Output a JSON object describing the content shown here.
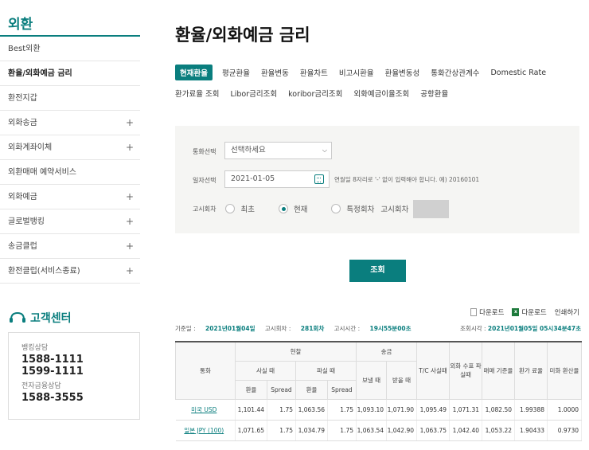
{
  "sidebar": {
    "title": "외환",
    "items": [
      {
        "label": "Best외환",
        "plus": ""
      },
      {
        "label": "환율/외화예금 금리",
        "plus": ""
      },
      {
        "label": "환전지갑",
        "plus": ""
      },
      {
        "label": "외화송금",
        "plus": "+"
      },
      {
        "label": "외화계좌이체",
        "plus": "+"
      },
      {
        "label": "외환매매 예약서비스",
        "plus": ""
      },
      {
        "label": "외화예금",
        "plus": "+"
      },
      {
        "label": "글로벌뱅킹",
        "plus": "+"
      },
      {
        "label": "송금클럽",
        "plus": "+"
      },
      {
        "label": "환전클럽(서비스종료)",
        "plus": "+"
      }
    ]
  },
  "customer_center": {
    "title": "고객센터",
    "bank_label": "뱅킹상담",
    "bank_num1": "1588-1111",
    "bank_num2": "1599-1111",
    "ef_label": "전자금융상담",
    "ef_num": "1588-3555"
  },
  "page_title": "환율/외화예금 금리",
  "tabs_row1": [
    "현재환율",
    "평균환율",
    "환율변동",
    "환율차트",
    "비고시환율",
    "환율변동성",
    "통화간상관계수",
    "Domestic Rate"
  ],
  "tabs_row2": [
    "환가료율 조회",
    "Libor금리조회",
    "koribor금리조회",
    "외화예금이율조회",
    "공항환율"
  ],
  "search": {
    "currency_label": "통화선택",
    "currency_value": "선택하세요",
    "date_label": "일자선택",
    "date_value": "2021-01-05",
    "date_hint": "연월일 8자리로 '-' 없이 입력해야 합니다. 예) 20160101",
    "notice_label": "고시회차",
    "opt_first": "최초",
    "opt_current": "현재",
    "opt_specific": "특정회차",
    "notice_round_label": "고시회차",
    "button": "조회"
  },
  "downloads": {
    "dl1": "다운로드",
    "dl2": "다운로드",
    "print": "인쇄하기"
  },
  "info": {
    "base_date_label": "기준일 :",
    "base_date": "2021년01월04일",
    "round_label": "고시회차 :",
    "round": "281회차",
    "time_label": "고시시간 :",
    "time": "19시55분00초",
    "query_label": "조회시각 :",
    "query_time": "2021년01월05일 05시34분47초"
  },
  "table": {
    "h_currency": "통화",
    "h_cash": "현찰",
    "h_remit": "송금",
    "h_tc": "T/C 사실때",
    "h_foreign_check": "외화 수표 파실때",
    "h_base": "매매 기준율",
    "h_conv": "환가 료율",
    "h_usd": "미화 환산율",
    "h_buy": "사실 때",
    "h_sell": "파실 때",
    "h_send": "보낼 때",
    "h_receive": "받을 때",
    "h_rate": "환율",
    "h_spread": "Spread",
    "rows": [
      [
        "미국 USD",
        "1,101.44",
        "1.75",
        "1,063.56",
        "1.75",
        "1,093.10",
        "1,071.90",
        "1,095.49",
        "1,071.31",
        "1,082.50",
        "1.99388",
        "1.0000"
      ],
      [
        "일본 JPY (100)",
        "1,071.65",
        "1.75",
        "1,034.79",
        "1.75",
        "1,063.54",
        "1,042.90",
        "1,063.75",
        "1,042.40",
        "1,053.22",
        "1.90433",
        "0.9730"
      ]
    ]
  }
}
